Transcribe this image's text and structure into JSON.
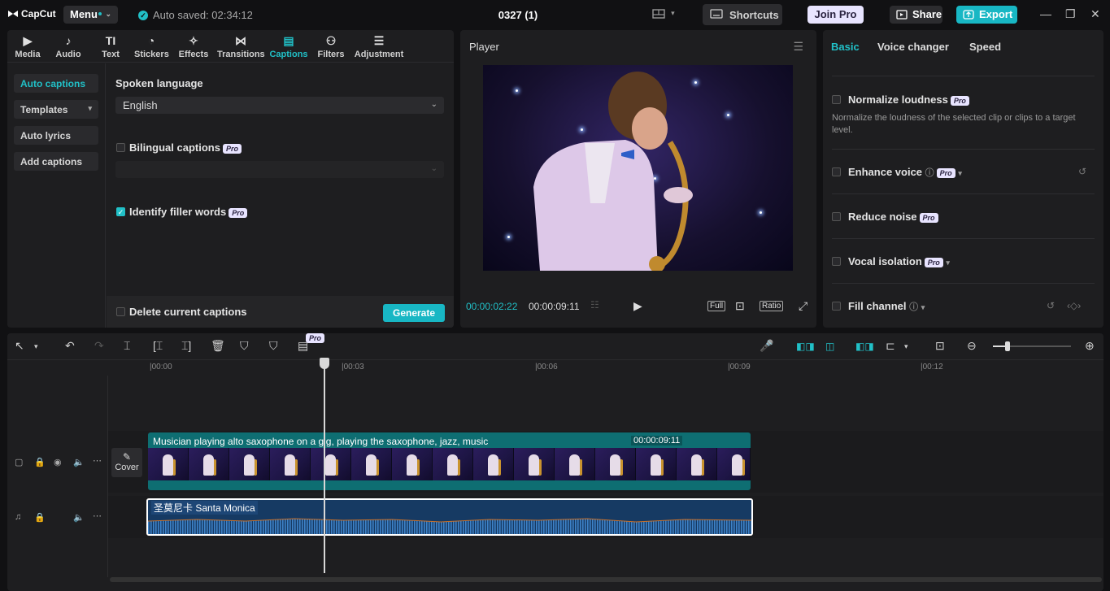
{
  "app": {
    "name": "CapCut",
    "menu_label": "Menu",
    "autosave": "Auto saved: 02:34:12",
    "project_title": "0327 (1)"
  },
  "header": {
    "shortcuts_label": "Shortcuts",
    "joinpro_label": "Join Pro",
    "share_label": "Share",
    "export_label": "Export"
  },
  "toolbar": {
    "items": [
      {
        "label": "Media",
        "icon": "media-icon"
      },
      {
        "label": "Audio",
        "icon": "audio-icon"
      },
      {
        "label": "Text",
        "icon": "text-icon"
      },
      {
        "label": "Stickers",
        "icon": "stickers-icon"
      },
      {
        "label": "Effects",
        "icon": "effects-icon"
      },
      {
        "label": "Transitions",
        "icon": "transitions-icon"
      },
      {
        "label": "Captions",
        "icon": "captions-icon",
        "active": true
      },
      {
        "label": "Filters",
        "icon": "filters-icon"
      },
      {
        "label": "Adjustment",
        "icon": "adjustment-icon"
      }
    ]
  },
  "sidenav": {
    "items": [
      "Auto captions",
      "Templates",
      "Auto lyrics",
      "Add captions"
    ]
  },
  "captions": {
    "spoken_language_label": "Spoken language",
    "spoken_language_value": "English",
    "bilingual_label": "Bilingual captions",
    "filler_label": "Identify filler words",
    "filler_checked": true,
    "delete_label": "Delete current captions",
    "generate_label": "Generate",
    "pro_badge": "Pro"
  },
  "player": {
    "title": "Player",
    "current_time": "00:00:02:22",
    "total_time": "00:00:09:11",
    "full_label": "Full",
    "ratio_label": "Ratio"
  },
  "right": {
    "tabs": [
      "Basic",
      "Voice changer",
      "Speed"
    ],
    "normalize_label": "Normalize loudness",
    "normalize_desc": "Normalize the loudness of the selected clip or clips to a target level.",
    "enhance_label": "Enhance voice",
    "reduce_label": "Reduce noise",
    "vocal_label": "Vocal isolation",
    "fill_label": "Fill channel"
  },
  "timeline": {
    "ticks": [
      "00:00",
      "00:03",
      "00:06",
      "00:09",
      "00:12"
    ],
    "video_clip_title": "Musician playing alto saxophone on a gig, playing the saxophone, jazz, music",
    "video_clip_duration": "00:00:09:11",
    "audio_clip_title": "圣莫尼卡 Santa Monica",
    "cover_label": "Cover",
    "pro_badge": "Pro"
  }
}
